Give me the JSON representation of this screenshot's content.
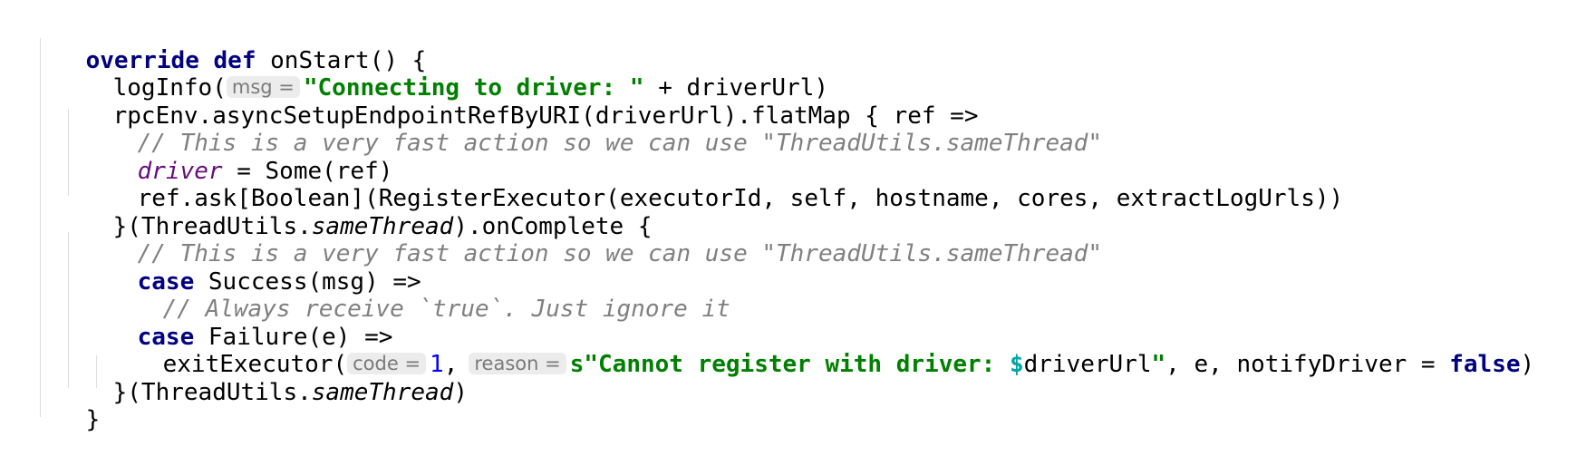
{
  "code": {
    "l1": {
      "kw1": "override",
      "kw2": "def",
      "rest": " onStart() {"
    },
    "l2": {
      "pre": "logInfo(",
      "hint": "msg =",
      "str": "\"Connecting to driver: \"",
      "post": " + driverUrl)"
    },
    "l3": {
      "text": "rpcEnv.asyncSetupEndpointRefByURI(driverUrl).flatMap { ref =>"
    },
    "l4": {
      "comment": "// This is a very fast action so we can use \"ThreadUtils.sameThread\""
    },
    "l5": {
      "field": "driver",
      "rest": " = Some(ref)"
    },
    "l6": {
      "text": "ref.ask[Boolean](RegisterExecutor(executorId, self, hostname, cores, extractLogUrls))"
    },
    "l7": {
      "pre": "}(ThreadUtils.",
      "ital": "sameThread",
      "post": ").onComplete {"
    },
    "l8": {
      "comment": "// This is a very fast action so we can use \"ThreadUtils.sameThread\""
    },
    "l9": {
      "kw": "case",
      "rest": " Success(msg) =>"
    },
    "l10": {
      "comment": "// Always receive `true`. Just ignore it"
    },
    "l11": {
      "kw": "case",
      "rest": " Failure(e) =>"
    },
    "l12": {
      "pre": "exitExecutor(",
      "hint1": "code =",
      "num": "1",
      "comma": ",",
      "hint2": "reason =",
      "str1": "s\"Cannot register with driver: ",
      "dollar": "$",
      "interp": "driverUrl",
      "str2": "\"",
      "post": ", e, notifyDriver = ",
      "kw": "false",
      "end": ")"
    },
    "l13": {
      "pre": "}(ThreadUtils.",
      "ital": "sameThread",
      "post": ")"
    },
    "l14": {
      "text": "}"
    }
  },
  "colors": {
    "keyword": "#000080",
    "string": "#008000",
    "comment": "#808080",
    "number": "#0000ff",
    "field": "#660e7a",
    "interpolation": "#00a5a5",
    "hint_bg": "#ececec"
  }
}
